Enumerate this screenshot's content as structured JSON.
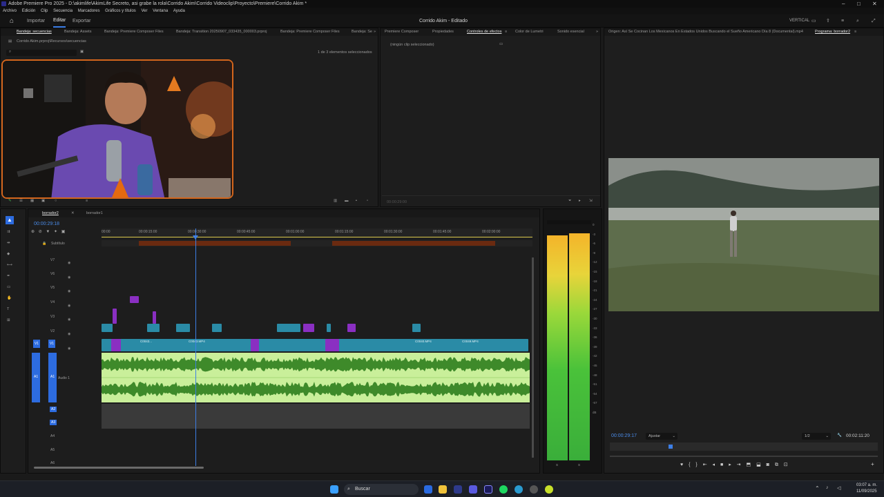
{
  "window": {
    "title": "Adobe Premiere Pro 2025 - D:\\akimlife\\AkimLife Secreto, asi grabe la rola\\Corrido Akim\\Corrido Videoclip\\Proyecto\\Premiere\\Corrido Akim *"
  },
  "menu": [
    "Archivo",
    "Edición",
    "Clip",
    "Secuencia",
    "Marcadores",
    "Gráficos y títulos",
    "Ver",
    "Ventana",
    "Ayuda"
  ],
  "header": {
    "tabs": [
      "Importar",
      "Editar",
      "Exportar"
    ],
    "active_tab": "Editar",
    "project_title": "Corrido Akim - Editado",
    "vertical_label": "VERTICAL"
  },
  "project_panel": {
    "tabs": [
      "Bandeja: secuencias",
      "Bandeja: Assets",
      "Bandeja: Premiere Composer Files",
      "Bandeja: Transition 20250907_033435_000003.prproj",
      "Bandeja: Premiere Composer Files",
      "Bandeja: Se"
    ],
    "path": "Corrido Akim.prproj\\Recursos\\secuencias",
    "selection_info": "1 de 3 elementos seleccionados"
  },
  "effects_panel": {
    "tabs": [
      "Premiere Composer",
      "Propiedades",
      "Controles de efectos",
      "Color de Lumetri",
      "Sonido esencial"
    ],
    "active_tab": "Controles de efectos",
    "no_clip": "(ningún clip seleccionado)",
    "timecode": "00:00:29:00"
  },
  "program_monitor": {
    "tabs": [
      "Origen: Así Se Cocinan Los Mexicanos En Estados Unidos  Buscando el Sueño Americano Día 8 (Documental).mp4",
      "Programa: borrador2"
    ],
    "current_time": "00:00:29:17",
    "fit": "Ajustar",
    "quality": "1/2",
    "duration": "00:02:11:20"
  },
  "timeline": {
    "tabs": [
      "borrador2",
      "borrador1"
    ],
    "timecode": "00:00:29:18",
    "ruler": [
      "00:00",
      "00:00:15:00",
      "00:00:30:00",
      "00:00:45:00",
      "00:01:00:00",
      "00:01:15:00",
      "00:01:30:00",
      "00:01:45:00",
      "00:02:00:00"
    ],
    "subtitle_track": "Subtítulo",
    "video_tracks": [
      "V7",
      "V6",
      "V5",
      "V4",
      "V3",
      "V2",
      "V1"
    ],
    "audio_tracks": [
      "A1",
      "A2",
      "A3",
      "A4",
      "A5",
      "A6"
    ],
    "audio1_name": "Audio 1",
    "v1_clips": [
      "C0043...",
      "C0043.MP4",
      "C0040.MP4",
      "C0049.MP4"
    ],
    "clip_colors": {
      "video": "#2a8ba6",
      "audio": "#c9ef9a",
      "adjust": "#8a2fc2",
      "subtitle": "#6a2a10"
    }
  },
  "meter": {
    "labels": [
      "0",
      "-3",
      "-6",
      "-9",
      "-12",
      "-15",
      "-18",
      "-21",
      "-24",
      "-27",
      "-30",
      "-33",
      "-36",
      "-39",
      "-42",
      "-45",
      "-48",
      "-51",
      "-54",
      "-57",
      "dB"
    ],
    "bottom": [
      "S",
      "S"
    ]
  },
  "taskbar": {
    "search": "Buscar",
    "time": "03:07 a. m.",
    "date": "11/09/2025"
  }
}
